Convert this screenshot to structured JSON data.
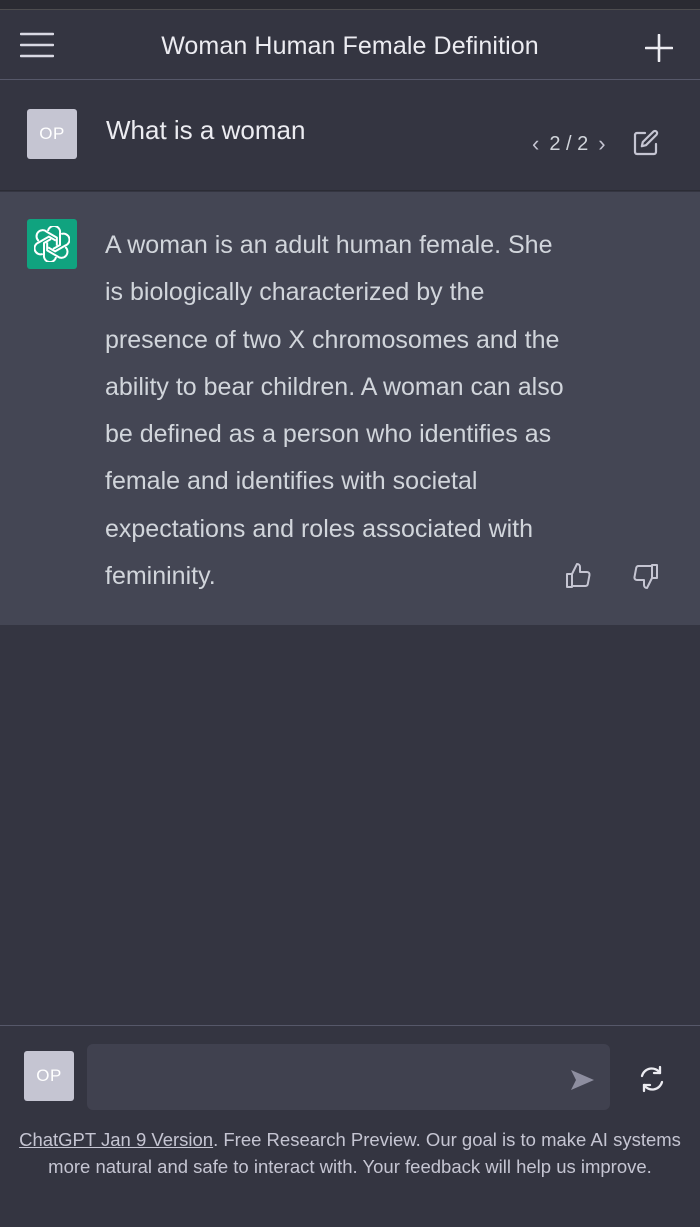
{
  "header": {
    "title": "Woman Human Female Definition",
    "menu_icon": "hamburger-menu-icon",
    "new_chat_icon": "plus-icon"
  },
  "user_message": {
    "avatar_initials": "OP",
    "text": "What is a woman",
    "pager": {
      "prev": "‹",
      "current": "2 / 2",
      "next": "›"
    },
    "edit_icon": "edit-icon"
  },
  "assistant_message": {
    "avatar_icon": "openai-logo-icon",
    "text": "A woman is an adult human female. She is biologically characterized by the presence of two X chromosomes and the ability to bear children. A woman can also be defined as a person who identifies as female and identifies with societal expectations and roles associated with femininity.",
    "feedback": {
      "up_icon": "thumbs-up-icon",
      "down_icon": "thumbs-down-icon"
    }
  },
  "composer": {
    "avatar_initials": "OP",
    "input_value": "",
    "input_placeholder": "",
    "send_icon": "send-icon",
    "regenerate_icon": "regenerate-icon"
  },
  "footer": {
    "version_link": "ChatGPT Jan 9 Version",
    "note": ". Free Research Preview. Our goal is to make AI systems more natural and safe to interact with. Your feedback will help us improve."
  },
  "colors": {
    "background": "#343541",
    "assistant_background": "#444654",
    "input_background": "#40414f",
    "accent": "#10a37f",
    "text": "#ececf1"
  }
}
